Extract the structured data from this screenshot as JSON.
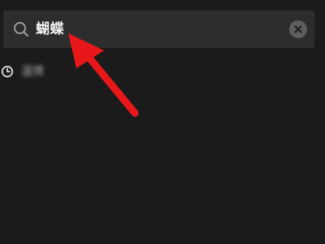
{
  "search": {
    "query": "蝴蝶",
    "search_icon": "search-icon",
    "clear_icon": "clear-icon"
  },
  "history": {
    "items": [
      {
        "label": "温情",
        "icon": "clock-icon",
        "blurred": true
      }
    ]
  },
  "annotation": {
    "type": "arrow",
    "color": "#e8171a"
  },
  "colors": {
    "background": "#1b1b1b",
    "search_box": "#2d2d2d",
    "text": "#f2f2f2",
    "muted_icon": "#9a9a9a",
    "clear_button": "#5e5e5e",
    "arrow": "#e8171a"
  }
}
